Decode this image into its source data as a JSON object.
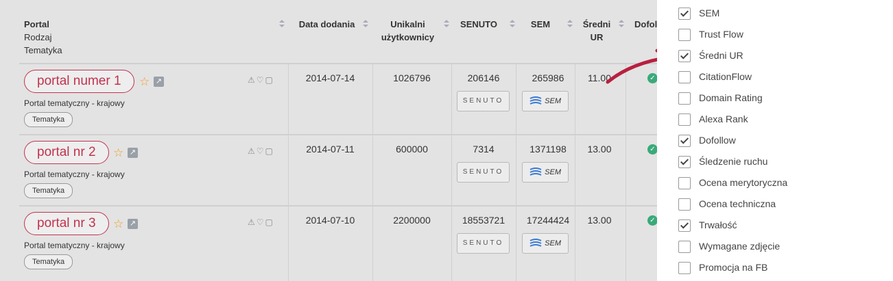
{
  "header": {
    "portal": "Portal",
    "rodzaj": "Rodzaj",
    "tematyka": "Tematyka",
    "data_dodania": "Data dodania",
    "unikalni_1": "Unikalni",
    "unikalni_2": "użytkownicy",
    "senuto": "SENUTO",
    "sem": "SEM",
    "sredni_1": "Średni",
    "sredni_2": "UR",
    "dofollow": "Dofol"
  },
  "rows": [
    {
      "name": "portal numer 1",
      "type": "Portal tematyczny - krajowy",
      "tag": "Tematyka",
      "date": "2014-07-14",
      "users": "1026796",
      "senuto": "206146",
      "sem": "265986",
      "ur": "11.00"
    },
    {
      "name": "portal nr 2",
      "type": "Portal tematyczny - krajowy",
      "tag": "Tematyka",
      "date": "2014-07-11",
      "users": "600000",
      "senuto": "7314",
      "sem": "1371198",
      "ur": "13.00"
    },
    {
      "name": "portal nr 3",
      "type": "Portal tematyczny - krajowy",
      "tag": "Tematyka",
      "date": "2014-07-10",
      "users": "2200000",
      "senuto": "18553721",
      "sem": "17244424",
      "ur": "13.00"
    }
  ],
  "buttons": {
    "senuto_logo": "SENUTO",
    "sem_logo": "SEM"
  },
  "icons": {
    "star": "star-outline-icon",
    "external": "external-link-icon",
    "warning": "warning-icon",
    "heart": "heart-icon",
    "note": "note-icon",
    "check": "check-circle-icon"
  },
  "colors": {
    "accent": "#c0334d",
    "check": "#3aaa7a",
    "star": "#f0a020"
  },
  "columns_panel": [
    {
      "label": "SEM",
      "checked": true
    },
    {
      "label": "Trust Flow",
      "checked": false
    },
    {
      "label": "Średni UR",
      "checked": true
    },
    {
      "label": "CitationFlow",
      "checked": false
    },
    {
      "label": "Domain Rating",
      "checked": false
    },
    {
      "label": "Alexa Rank",
      "checked": false
    },
    {
      "label": "Dofollow",
      "checked": true
    },
    {
      "label": "Śledzenie ruchu",
      "checked": true
    },
    {
      "label": "Ocena merytoryczna",
      "checked": false
    },
    {
      "label": "Ocena techniczna",
      "checked": false
    },
    {
      "label": "Trwałość",
      "checked": true
    },
    {
      "label": "Wymagane zdjęcie",
      "checked": false
    },
    {
      "label": "Promocja na FB",
      "checked": false
    }
  ]
}
